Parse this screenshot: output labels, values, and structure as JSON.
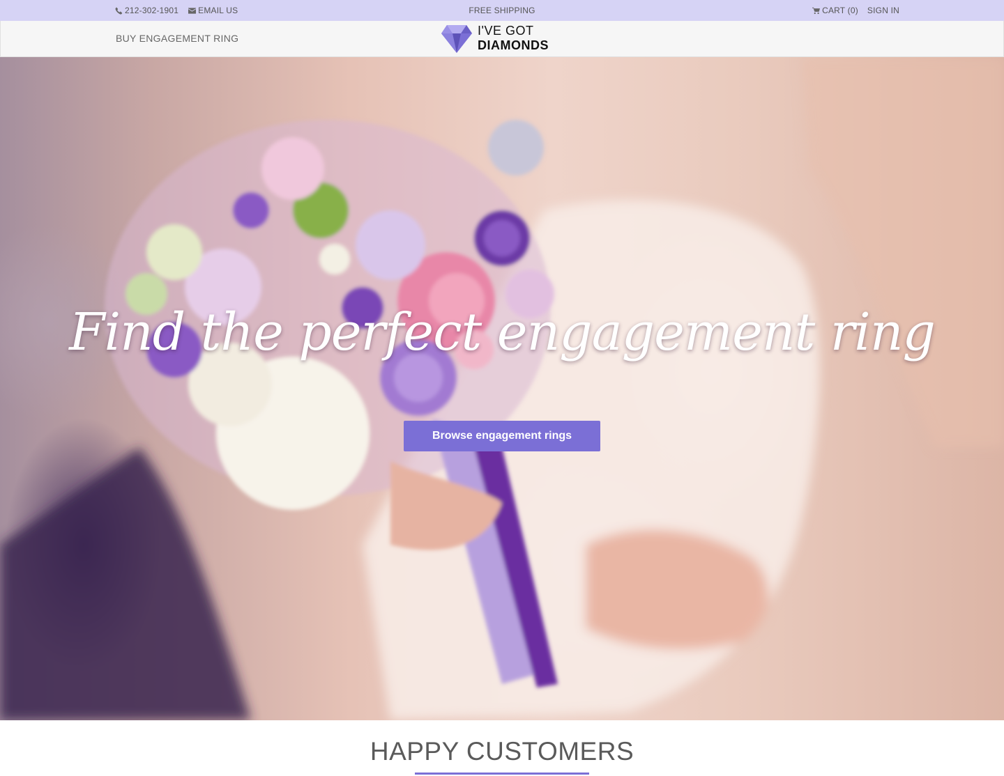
{
  "topbar": {
    "phone": "212-302-1901",
    "email_label": "EMAIL US",
    "promo": "FREE SHIPPING",
    "cart_label": "CART (0)",
    "signin_label": "SIGN IN"
  },
  "nav": {
    "buy_label": "BUY ENGAGEMENT RING",
    "logo_line1": "I'VE GOT",
    "logo_line2": "DIAMONDS"
  },
  "hero": {
    "headline": "Find the perfect engagement ring",
    "cta_label": "Browse engagement rings"
  },
  "customers": {
    "heading": "HAPPY CUSTOMERS"
  },
  "colors": {
    "accent": "#7b6fd6",
    "topbar_bg": "#d6d3f5",
    "nav_bg": "#f6f6f6"
  },
  "icons": {
    "phone": "phone-icon",
    "email": "envelope-icon",
    "cart": "cart-icon",
    "logo": "diamond-icon"
  }
}
